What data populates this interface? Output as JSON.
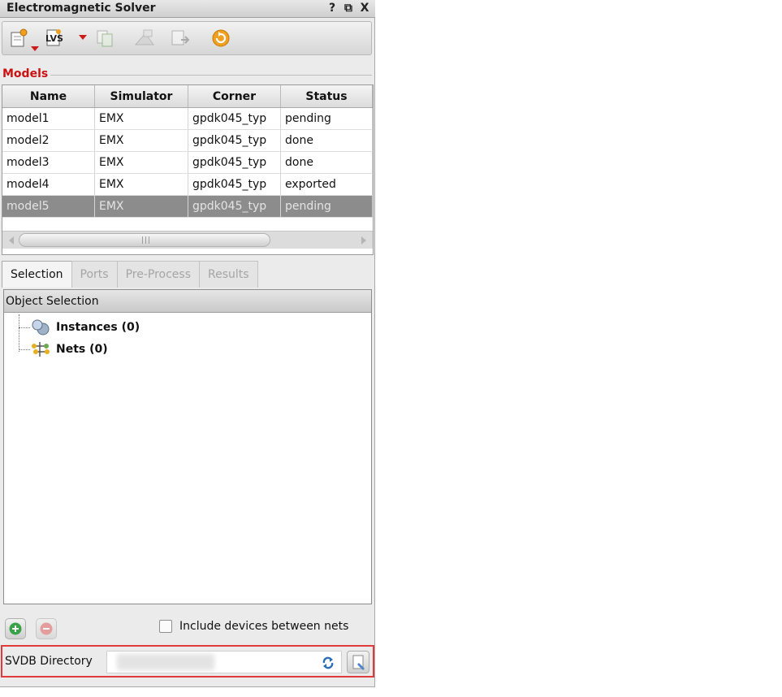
{
  "window": {
    "title": "Electromagnetic Solver",
    "help": "?",
    "restore": "⧉",
    "close": "X"
  },
  "toolbar": {
    "lvs_text": "LVS"
  },
  "models": {
    "section_label": "Models",
    "columns": [
      "Name",
      "Simulator",
      "Corner",
      "Status"
    ],
    "rows": [
      {
        "name": "model1",
        "simulator": "EMX",
        "corner": "gpdk045_typ",
        "status": "pending"
      },
      {
        "name": "model2",
        "simulator": "EMX",
        "corner": "gpdk045_typ",
        "status": "done"
      },
      {
        "name": "model3",
        "simulator": "EMX",
        "corner": "gpdk045_typ",
        "status": "done"
      },
      {
        "name": "model4",
        "simulator": "EMX",
        "corner": "gpdk045_typ",
        "status": "exported"
      },
      {
        "name": "model5",
        "simulator": "EMX",
        "corner": "gpdk045_typ",
        "status": "pending"
      }
    ],
    "selected_row": "model5"
  },
  "tabs": [
    {
      "label": "Selection",
      "active": true
    },
    {
      "label": "Ports",
      "active": false
    },
    {
      "label": "Pre-Process",
      "active": false
    },
    {
      "label": "Results",
      "active": false
    }
  ],
  "selection": {
    "header": "Object Selection",
    "items": [
      {
        "label": "Instances (0)",
        "icon": "instances-icon"
      },
      {
        "label": "Nets (0)",
        "icon": "nets-icon"
      }
    ]
  },
  "bottom": {
    "include_devices_label": "Include devices between nets",
    "include_devices_checked": false
  },
  "svdb": {
    "label": "SVDB Directory",
    "value": ""
  },
  "colors": {
    "section_label": "#cc1111",
    "selected_row": "#8c8c8c",
    "highlight_border": "#e03a3a"
  }
}
